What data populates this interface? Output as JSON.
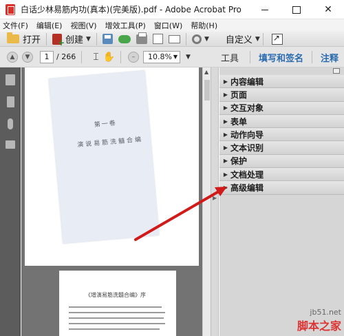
{
  "window": {
    "title": "白话少林易筋内功(真本)(完美版).pdf - Adobe Acrobat Pro",
    "minimize": "",
    "maximize": "",
    "close": "✕"
  },
  "menu": [
    "文件(F)",
    "编辑(E)",
    "视图(V)",
    "增效工具(P)",
    "窗口(W)",
    "帮助(H)"
  ],
  "toolbar": {
    "open_label": "打开",
    "create_label": "创建",
    "customize_label": "自定义"
  },
  "nav": {
    "current_page": "1",
    "total_pages": "/ 266",
    "zoom": "10.8%"
  },
  "right_tabs": {
    "tools": "工具",
    "fill_sign": "填写和签名",
    "comment": "注释"
  },
  "tool_panels": [
    "内容编辑",
    "页面",
    "交互对象",
    "表单",
    "动作向导",
    "文本识别",
    "保护",
    "文档处理",
    "高级编辑"
  ],
  "document": {
    "page1_volume": "第一卷",
    "page1_title": "演说易筋洗髓合编",
    "page2_title": "《增演易筋洗髓合编》序"
  },
  "watermark": {
    "domain": "jb51.net",
    "site_name": "脚本之家"
  },
  "colors": {
    "annotation_arrow": "#d11a1a",
    "link_blue": "#2a6bb0"
  }
}
